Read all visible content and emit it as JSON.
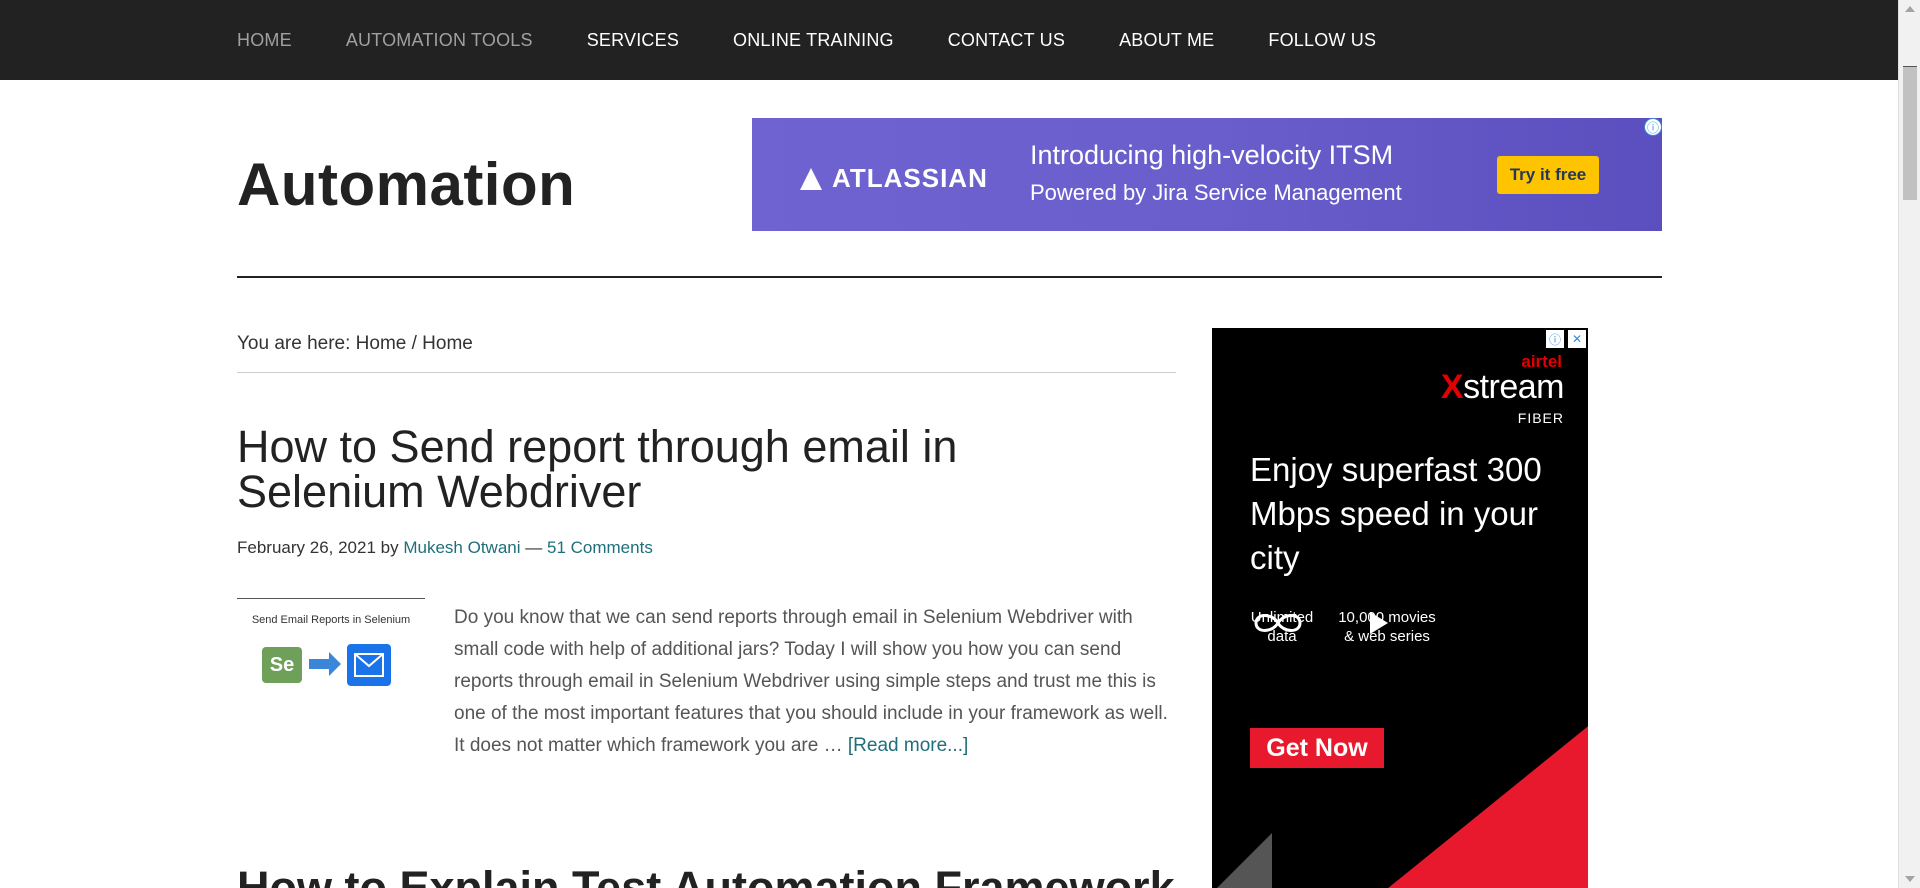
{
  "nav": {
    "items": [
      {
        "label": "HOME",
        "dim": true
      },
      {
        "label": "AUTOMATION TOOLS",
        "dim": true
      },
      {
        "label": "SERVICES",
        "dim": false
      },
      {
        "label": "ONLINE TRAINING",
        "dim": false
      },
      {
        "label": "CONTACT US",
        "dim": false
      },
      {
        "label": "ABOUT ME",
        "dim": false
      },
      {
        "label": "FOLLOW US",
        "dim": false
      }
    ]
  },
  "header": {
    "site_title": "Automation"
  },
  "ad_top": {
    "brand": "ATLASSIAN",
    "line1": "Introducing high-velocity ITSM",
    "line2": "Powered by Jira Service Management",
    "cta": "Try it free",
    "info_icon": "ⓘ"
  },
  "breadcrumb": {
    "text": "You are here: Home / Home"
  },
  "post": {
    "title": "How to Send report through email in Selenium Webdriver",
    "date": "February 26, 2021",
    "by": "by",
    "author": "Mukesh Otwani",
    "separator": "—",
    "comments": "51 Comments",
    "thumbnail_caption": "Send Email Reports in Selenium",
    "thumbnail_se": "Se",
    "excerpt": "Do you know that we can send reports through email in Selenium Webdriver with small code with help of additional jars? Today I will show you how you can send reports through email in Selenium Webdriver using simple steps and trust me this is one of the most important features that you should include in your framework as well. It does not matter which framework you are …",
    "read_more": "[Read more...]"
  },
  "next_post": {
    "title": "How to Explain Test Automation Framework"
  },
  "ad_side": {
    "brand_top": "airtel",
    "brand_x": "X",
    "brand_stream": "stream",
    "brand_sub": "FIBER",
    "headline": "Enjoy superfast 300 Mbps speed in your city",
    "feature1_line1": "Unlimited",
    "feature1_line2": "data",
    "feature2_line1": "10,000 movies",
    "feature2_line2": "& web series",
    "cta": "Get Now",
    "info_icon": "ⓘ",
    "close_icon": "✕"
  },
  "colors": {
    "nav_bg": "#222222",
    "link": "#1f6f7a",
    "ad_top_bg": "#6a5ecc",
    "ad_top_cta": "#ffc400",
    "ad_side_red": "#e8192c"
  }
}
